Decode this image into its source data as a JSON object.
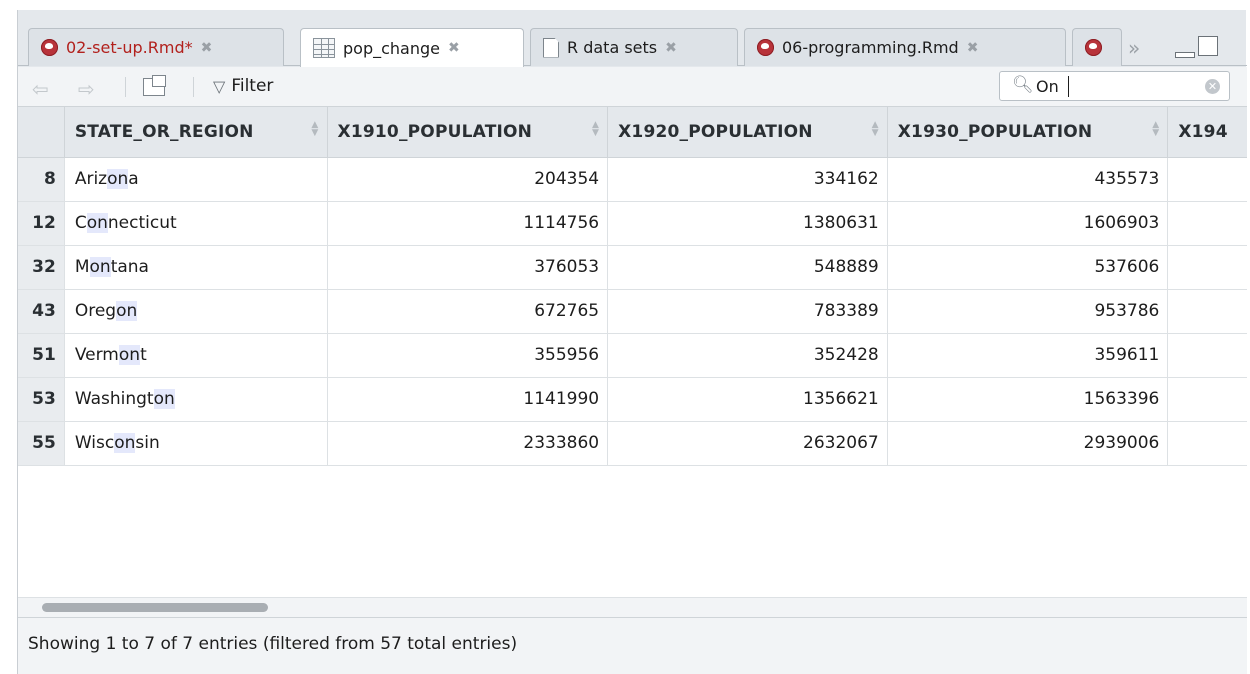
{
  "tabs": [
    {
      "label": "02-set-up.Rmd*",
      "icon": "rmd-icon",
      "modified": true,
      "active": false
    },
    {
      "label": "pop_change",
      "icon": "grid-icon",
      "modified": false,
      "active": true
    },
    {
      "label": "R data sets",
      "icon": "document-icon",
      "modified": false,
      "active": false
    },
    {
      "label": "06-programming.Rmd",
      "icon": "rmd-icon",
      "modified": false,
      "active": false
    }
  ],
  "toolbar": {
    "filter_label": "Filter"
  },
  "search": {
    "value": "On"
  },
  "table": {
    "columns": [
      "STATE_OR_REGION",
      "X1910_POPULATION",
      "X1920_POPULATION",
      "X1930_POPULATION",
      "X194"
    ],
    "rows": [
      {
        "index": "8",
        "state": [
          "Ariz",
          "on",
          "a"
        ],
        "values": [
          "204354",
          "334162",
          "435573"
        ]
      },
      {
        "index": "12",
        "state": [
          "C",
          "on",
          "necticut"
        ],
        "values": [
          "1114756",
          "1380631",
          "1606903"
        ]
      },
      {
        "index": "32",
        "state": [
          "M",
          "on",
          "tana"
        ],
        "values": [
          "376053",
          "548889",
          "537606"
        ]
      },
      {
        "index": "43",
        "state": [
          "Oreg",
          "on",
          ""
        ],
        "values": [
          "672765",
          "783389",
          "953786"
        ]
      },
      {
        "index": "51",
        "state": [
          "Verm",
          "on",
          "t"
        ],
        "values": [
          "355956",
          "352428",
          "359611"
        ]
      },
      {
        "index": "53",
        "state": [
          "Washingt",
          "on",
          ""
        ],
        "values": [
          "1141990",
          "1356621",
          "1563396"
        ]
      },
      {
        "index": "55",
        "state": [
          "Wisc",
          "on",
          "sin"
        ],
        "values": [
          "2333860",
          "2632067",
          "2939006"
        ]
      }
    ]
  },
  "status": {
    "text": "Showing 1 to 7 of 7 entries (filtered from 57 total entries)"
  },
  "colors": {
    "modified_tab": "#b2211d",
    "match_highlight": "#e4e8fb",
    "header_bg": "#e4e8ec"
  }
}
